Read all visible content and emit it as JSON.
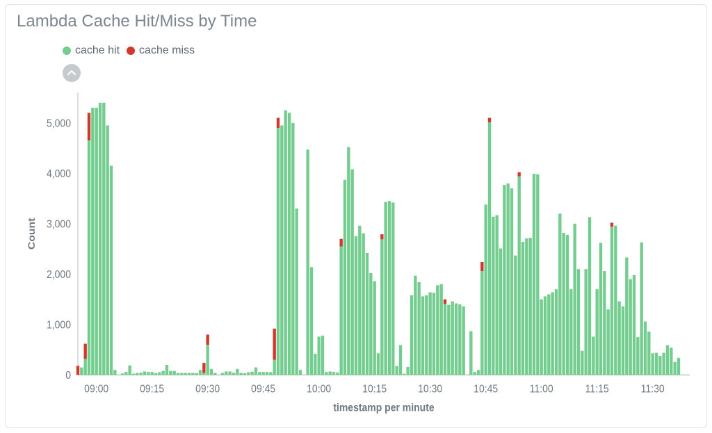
{
  "title": "Lambda Cache Hit/Miss by Time",
  "legend": [
    {
      "id": "hit",
      "label": "cache hit",
      "color": "#74cd8e"
    },
    {
      "id": "miss",
      "label": "cache miss",
      "color": "#cf3a2d"
    }
  ],
  "axes": {
    "ylabel": "Count",
    "xlabel": "timestamp per minute",
    "yticks": [
      0,
      1000,
      2000,
      3000,
      4000,
      5000
    ],
    "ytick_labels": [
      "0",
      "1,000",
      "2,000",
      "3,000",
      "4,000",
      "5,000"
    ],
    "ymax": 5600,
    "xticks": [
      "09:00",
      "09:15",
      "09:30",
      "09:45",
      "10:00",
      "10:15",
      "10:30",
      "10:45",
      "11:00",
      "11:15",
      "11:30"
    ]
  },
  "chart_data": {
    "type": "bar",
    "stacked": true,
    "title": "Lambda Cache Hit/Miss by Time",
    "xlabel": "timestamp per minute",
    "ylabel": "Count",
    "ylim": [
      0,
      5600
    ],
    "x_range_minutes": [
      -5,
      160
    ],
    "series_order": [
      "cache hit",
      "cache miss"
    ],
    "data": [
      {
        "m": -5,
        "hit": 0,
        "miss": 180
      },
      {
        "m": -4,
        "hit": 150,
        "miss": 0
      },
      {
        "m": -3,
        "hit": 320,
        "miss": 300
      },
      {
        "m": -2,
        "hit": 4650,
        "miss": 550
      },
      {
        "m": -1,
        "hit": 5300,
        "miss": 0
      },
      {
        "m": 0,
        "hit": 5300,
        "miss": 0
      },
      {
        "m": 1,
        "hit": 5400,
        "miss": 0
      },
      {
        "m": 2,
        "hit": 5400,
        "miss": 0
      },
      {
        "m": 3,
        "hit": 4950,
        "miss": 0
      },
      {
        "m": 4,
        "hit": 4150,
        "miss": 0
      },
      {
        "m": 5,
        "hit": 100,
        "miss": 0
      },
      {
        "m": 6,
        "hit": 0,
        "miss": 0
      },
      {
        "m": 7,
        "hit": 30,
        "miss": 0
      },
      {
        "m": 8,
        "hit": 60,
        "miss": 0
      },
      {
        "m": 9,
        "hit": 190,
        "miss": 0
      },
      {
        "m": 10,
        "hit": 25,
        "miss": 0
      },
      {
        "m": 11,
        "hit": 40,
        "miss": 0
      },
      {
        "m": 12,
        "hit": 45,
        "miss": 0
      },
      {
        "m": 13,
        "hit": 70,
        "miss": 0
      },
      {
        "m": 14,
        "hit": 60,
        "miss": 0
      },
      {
        "m": 15,
        "hit": 60,
        "miss": 0
      },
      {
        "m": 16,
        "hit": 35,
        "miss": 0
      },
      {
        "m": 17,
        "hit": 55,
        "miss": 0
      },
      {
        "m": 18,
        "hit": 80,
        "miss": 0
      },
      {
        "m": 19,
        "hit": 200,
        "miss": 0
      },
      {
        "m": 20,
        "hit": 80,
        "miss": 0
      },
      {
        "m": 21,
        "hit": 80,
        "miss": 0
      },
      {
        "m": 22,
        "hit": 40,
        "miss": 0
      },
      {
        "m": 23,
        "hit": 40,
        "miss": 0
      },
      {
        "m": 24,
        "hit": 40,
        "miss": 0
      },
      {
        "m": 25,
        "hit": 40,
        "miss": 0
      },
      {
        "m": 26,
        "hit": 40,
        "miss": 0
      },
      {
        "m": 27,
        "hit": 35,
        "miss": 0
      },
      {
        "m": 28,
        "hit": 100,
        "miss": 0
      },
      {
        "m": 29,
        "hit": 40,
        "miss": 200
      },
      {
        "m": 30,
        "hit": 600,
        "miss": 200
      },
      {
        "m": 31,
        "hit": 120,
        "miss": 0
      },
      {
        "m": 32,
        "hit": 40,
        "miss": 0
      },
      {
        "m": 33,
        "hit": 0,
        "miss": 0
      },
      {
        "m": 34,
        "hit": 40,
        "miss": 0
      },
      {
        "m": 35,
        "hit": 70,
        "miss": 0
      },
      {
        "m": 36,
        "hit": 70,
        "miss": 0
      },
      {
        "m": 37,
        "hit": 45,
        "miss": 0
      },
      {
        "m": 38,
        "hit": 120,
        "miss": 0
      },
      {
        "m": 39,
        "hit": 40,
        "miss": 0
      },
      {
        "m": 40,
        "hit": 35,
        "miss": 0
      },
      {
        "m": 41,
        "hit": 55,
        "miss": 0
      },
      {
        "m": 42,
        "hit": 65,
        "miss": 0
      },
      {
        "m": 43,
        "hit": 150,
        "miss": 0
      },
      {
        "m": 44,
        "hit": 60,
        "miss": 0
      },
      {
        "m": 45,
        "hit": 60,
        "miss": 0
      },
      {
        "m": 46,
        "hit": 60,
        "miss": 0
      },
      {
        "m": 47,
        "hit": 55,
        "miss": 0
      },
      {
        "m": 48,
        "hit": 300,
        "miss": 620
      },
      {
        "m": 49,
        "hit": 4900,
        "miss": 200
      },
      {
        "m": 50,
        "hit": 4950,
        "miss": 0
      },
      {
        "m": 51,
        "hit": 5250,
        "miss": 0
      },
      {
        "m": 52,
        "hit": 5200,
        "miss": 0
      },
      {
        "m": 53,
        "hit": 5000,
        "miss": 0
      },
      {
        "m": 54,
        "hit": 3300,
        "miss": 0
      },
      {
        "m": 55,
        "hit": 100,
        "miss": 0
      },
      {
        "m": 56,
        "hit": 0,
        "miss": 0
      },
      {
        "m": 57,
        "hit": 4470,
        "miss": 0
      },
      {
        "m": 58,
        "hit": 2140,
        "miss": 0
      },
      {
        "m": 59,
        "hit": 420,
        "miss": 0
      },
      {
        "m": 60,
        "hit": 760,
        "miss": 0
      },
      {
        "m": 61,
        "hit": 780,
        "miss": 0
      },
      {
        "m": 62,
        "hit": 60,
        "miss": 0
      },
      {
        "m": 63,
        "hit": 70,
        "miss": 0
      },
      {
        "m": 64,
        "hit": 60,
        "miss": 0
      },
      {
        "m": 65,
        "hit": 50,
        "miss": 0
      },
      {
        "m": 66,
        "hit": 2550,
        "miss": 150
      },
      {
        "m": 67,
        "hit": 3870,
        "miss": 0
      },
      {
        "m": 68,
        "hit": 4520,
        "miss": 0
      },
      {
        "m": 69,
        "hit": 4080,
        "miss": 0
      },
      {
        "m": 70,
        "hit": 2750,
        "miss": 0
      },
      {
        "m": 71,
        "hit": 2960,
        "miss": 0
      },
      {
        "m": 72,
        "hit": 2810,
        "miss": 0
      },
      {
        "m": 73,
        "hit": 2420,
        "miss": 0
      },
      {
        "m": 74,
        "hit": 2020,
        "miss": 0
      },
      {
        "m": 75,
        "hit": 1860,
        "miss": 0
      },
      {
        "m": 76,
        "hit": 430,
        "miss": 0
      },
      {
        "m": 77,
        "hit": 2690,
        "miss": 100
      },
      {
        "m": 78,
        "hit": 3430,
        "miss": 0
      },
      {
        "m": 79,
        "hit": 3450,
        "miss": 0
      },
      {
        "m": 80,
        "hit": 3420,
        "miss": 0
      },
      {
        "m": 81,
        "hit": 180,
        "miss": 0
      },
      {
        "m": 82,
        "hit": 590,
        "miss": 0
      },
      {
        "m": 83,
        "hit": 25,
        "miss": 0
      },
      {
        "m": 84,
        "hit": 160,
        "miss": 0
      },
      {
        "m": 85,
        "hit": 1580,
        "miss": 0
      },
      {
        "m": 86,
        "hit": 1970,
        "miss": 0
      },
      {
        "m": 87,
        "hit": 1840,
        "miss": 0
      },
      {
        "m": 88,
        "hit": 1560,
        "miss": 0
      },
      {
        "m": 89,
        "hit": 1580,
        "miss": 0
      },
      {
        "m": 90,
        "hit": 1640,
        "miss": 0
      },
      {
        "m": 91,
        "hit": 1630,
        "miss": 0
      },
      {
        "m": 92,
        "hit": 1780,
        "miss": 0
      },
      {
        "m": 93,
        "hit": 1800,
        "miss": 0
      },
      {
        "m": 94,
        "hit": 1410,
        "miss": 90
      },
      {
        "m": 95,
        "hit": 1390,
        "miss": 0
      },
      {
        "m": 96,
        "hit": 1460,
        "miss": 0
      },
      {
        "m": 97,
        "hit": 1420,
        "miss": 0
      },
      {
        "m": 98,
        "hit": 1400,
        "miss": 0
      },
      {
        "m": 99,
        "hit": 1360,
        "miss": 0
      },
      {
        "m": 100,
        "hit": 0,
        "miss": 0
      },
      {
        "m": 101,
        "hit": 870,
        "miss": 0
      },
      {
        "m": 102,
        "hit": 60,
        "miss": 0
      },
      {
        "m": 103,
        "hit": 100,
        "miss": 0
      },
      {
        "m": 104,
        "hit": 2060,
        "miss": 180
      },
      {
        "m": 105,
        "hit": 3380,
        "miss": 0
      },
      {
        "m": 106,
        "hit": 5010,
        "miss": 90
      },
      {
        "m": 107,
        "hit": 3140,
        "miss": 0
      },
      {
        "m": 108,
        "hit": 3170,
        "miss": 0
      },
      {
        "m": 109,
        "hit": 2510,
        "miss": 0
      },
      {
        "m": 110,
        "hit": 3770,
        "miss": 0
      },
      {
        "m": 111,
        "hit": 3800,
        "miss": 0
      },
      {
        "m": 112,
        "hit": 3700,
        "miss": 0
      },
      {
        "m": 113,
        "hit": 2370,
        "miss": 0
      },
      {
        "m": 114,
        "hit": 3940,
        "miss": 80
      },
      {
        "m": 115,
        "hit": 2640,
        "miss": 0
      },
      {
        "m": 116,
        "hit": 2710,
        "miss": 0
      },
      {
        "m": 117,
        "hit": 2720,
        "miss": 0
      },
      {
        "m": 118,
        "hit": 3990,
        "miss": 0
      },
      {
        "m": 119,
        "hit": 3980,
        "miss": 0
      },
      {
        "m": 120,
        "hit": 1500,
        "miss": 0
      },
      {
        "m": 121,
        "hit": 1560,
        "miss": 0
      },
      {
        "m": 122,
        "hit": 1600,
        "miss": 0
      },
      {
        "m": 123,
        "hit": 1640,
        "miss": 0
      },
      {
        "m": 124,
        "hit": 1700,
        "miss": 0
      },
      {
        "m": 125,
        "hit": 3200,
        "miss": 0
      },
      {
        "m": 126,
        "hit": 2820,
        "miss": 0
      },
      {
        "m": 127,
        "hit": 2780,
        "miss": 0
      },
      {
        "m": 128,
        "hit": 1700,
        "miss": 0
      },
      {
        "m": 129,
        "hit": 3000,
        "miss": 0
      },
      {
        "m": 130,
        "hit": 2100,
        "miss": 0
      },
      {
        "m": 131,
        "hit": 480,
        "miss": 0
      },
      {
        "m": 132,
        "hit": 2100,
        "miss": 0
      },
      {
        "m": 133,
        "hit": 3130,
        "miss": 0
      },
      {
        "m": 134,
        "hit": 760,
        "miss": 0
      },
      {
        "m": 135,
        "hit": 1700,
        "miss": 0
      },
      {
        "m": 136,
        "hit": 2620,
        "miss": 0
      },
      {
        "m": 137,
        "hit": 2060,
        "miss": 0
      },
      {
        "m": 138,
        "hit": 1300,
        "miss": 0
      },
      {
        "m": 139,
        "hit": 2940,
        "miss": 80
      },
      {
        "m": 140,
        "hit": 2960,
        "miss": 0
      },
      {
        "m": 141,
        "hit": 1460,
        "miss": 0
      },
      {
        "m": 142,
        "hit": 1360,
        "miss": 0
      },
      {
        "m": 143,
        "hit": 2330,
        "miss": 0
      },
      {
        "m": 144,
        "hit": 1900,
        "miss": 0
      },
      {
        "m": 145,
        "hit": 1980,
        "miss": 0
      },
      {
        "m": 146,
        "hit": 750,
        "miss": 0
      },
      {
        "m": 147,
        "hit": 2630,
        "miss": 0
      },
      {
        "m": 148,
        "hit": 1060,
        "miss": 0
      },
      {
        "m": 149,
        "hit": 860,
        "miss": 0
      },
      {
        "m": 150,
        "hit": 430,
        "miss": 0
      },
      {
        "m": 151,
        "hit": 440,
        "miss": 0
      },
      {
        "m": 152,
        "hit": 380,
        "miss": 0
      },
      {
        "m": 153,
        "hit": 440,
        "miss": 0
      },
      {
        "m": 154,
        "hit": 590,
        "miss": 0
      },
      {
        "m": 155,
        "hit": 540,
        "miss": 0
      },
      {
        "m": 156,
        "hit": 260,
        "miss": 0
      },
      {
        "m": 157,
        "hit": 340,
        "miss": 0
      }
    ]
  }
}
